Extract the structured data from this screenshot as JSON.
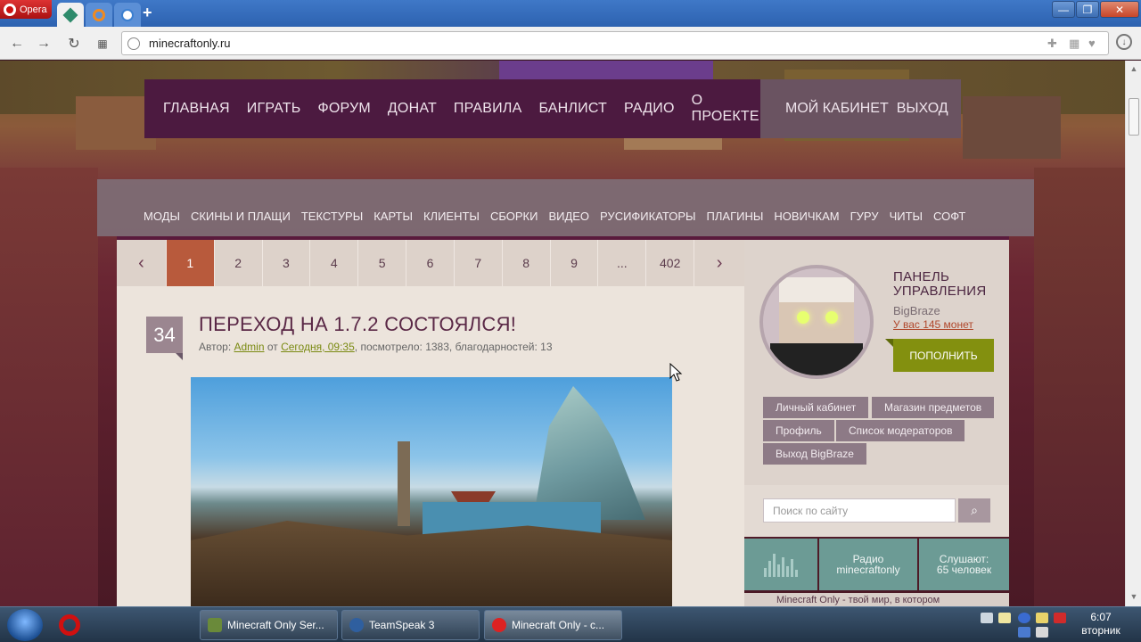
{
  "browser": {
    "opera_label": "Opera",
    "url": "minecraftonly.ru",
    "window_controls": {
      "minimize": "—",
      "maximize": "❐",
      "close": "✕"
    }
  },
  "site": {
    "top_nav": [
      "ГЛАВНАЯ",
      "ИГРАТЬ",
      "ФОРУМ",
      "ДОНАТ",
      "ПРАВИЛА",
      "БАНЛИСТ",
      "РАДИО",
      "О ПРОЕКТЕ"
    ],
    "top_nav_right": [
      "МОЙ КАБИНЕТ",
      "ВЫХОД"
    ],
    "sub_nav": [
      "МОДЫ",
      "СКИНЫ И ПЛАЩИ",
      "ТЕКСТУРЫ",
      "КАРТЫ",
      "КЛИЕНТЫ",
      "СБОРКИ",
      "ВИДЕО",
      "РУСИФИКАТОРЫ",
      "ПЛАГИНЫ",
      "НОВИЧКАМ",
      "ГУРУ",
      "ЧИТЫ",
      "СОФТ"
    ],
    "pager": {
      "prev": "‹",
      "pages": [
        "1",
        "2",
        "3",
        "4",
        "5",
        "6",
        "7",
        "8",
        "9",
        "...",
        "402"
      ],
      "active": "1",
      "next": "›"
    },
    "post": {
      "number": "34",
      "title": "ПЕРЕХОД НА 1.7.2 СОСТОЯЛСЯ!",
      "meta_author_prefix": "Автор: ",
      "author": "Admin",
      "meta_from": " от ",
      "date": "Сегодня, 09:35",
      "meta_rest": ", посмотрело: 1383, благодарностей: 13"
    },
    "panel": {
      "title_line1": "ПАНЕЛЬ",
      "title_line2": "УПРАВЛЕНИЯ",
      "username": "BigBraze",
      "coins": "У вас 145 монет",
      "topup_button": "ПОПОЛНИТЬ",
      "links": [
        "Личный кабинет",
        "Магазин предметов",
        "Профиль",
        "Список модераторов",
        "Выход BigBraze"
      ]
    },
    "search": {
      "placeholder": "Поиск по сайту"
    },
    "radio": {
      "label_line1": "Радио",
      "label_line2": "minecraftonly",
      "listeners_line1": "Слушают:",
      "listeners_line2": "65 человек"
    },
    "partial_bottom_text": "Minecraft Only - твой мир, в котором"
  },
  "taskbar": {
    "items": [
      "Minecraft Only Ser...",
      "TeamSpeak 3",
      "Minecraft Only - c..."
    ],
    "time": "6:07",
    "day": "вторник"
  },
  "colors": {
    "nav_dark": "#4c1a40",
    "active_page": "#b85a3c",
    "accent_green": "#83900f",
    "radio_teal": "#6c9b95"
  }
}
